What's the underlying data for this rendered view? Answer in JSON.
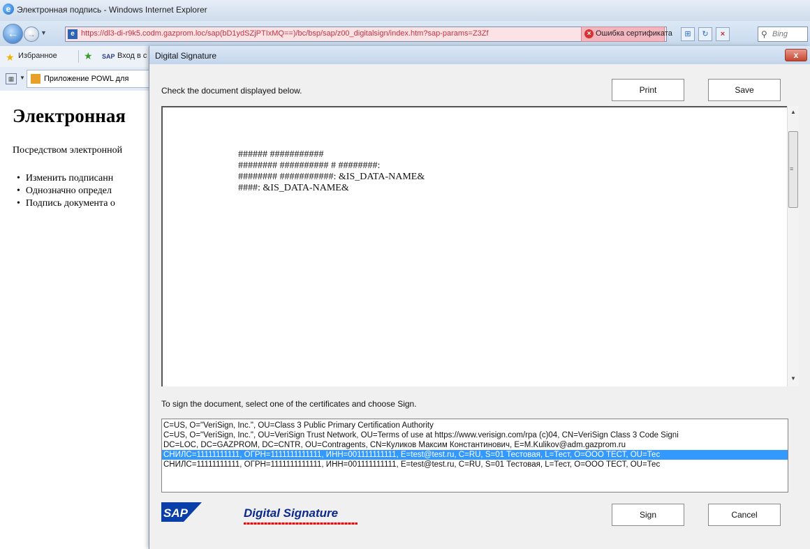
{
  "browser": {
    "window_title": "Электронная подпись - Windows Internet Explorer",
    "url": "https://dl3-di-r9k5.codm.gazprom.loc/sap(bD1ydSZjPTIxMQ==)/bc/bsp/sap/z00_digitalsign/index.htm?sap-params=Z3Zf",
    "cert_error": "Ошибка сертификата",
    "search_placeholder": "Bing",
    "favorites_label": "Избранное",
    "favorite_link": "Вход в с",
    "tab_title": "Приложение POWL для"
  },
  "page": {
    "heading": "Электронная",
    "intro": "Посредством электронной",
    "bullets": [
      "Изменить подписанн",
      "Однозначно определ",
      "Подпись документа о"
    ]
  },
  "dialog": {
    "title": "Digital Signature",
    "check_text": "Check the document displayed below.",
    "print_label": "Print",
    "save_label": "Save",
    "document_lines": [
      "######  ###########",
      "########  ##########  #  ########:",
      "########  ###########:  &IS_DATA-NAME&",
      "####:  &IS_DATA-NAME&"
    ],
    "sign_instruction": "To sign the document, select one of the certificates and choose Sign.",
    "certificates": [
      "C=US, O=\"VeriSign, Inc.\", OU=Class 3 Public Primary Certification Authority",
      "C=US, O=\"VeriSign, Inc.\", OU=VeriSign Trust Network, OU=Terms of use at https://www.verisign.com/rpa (c)04, CN=VeriSign Class 3 Code Signi",
      "DC=LOC, DC=GAZPROM, DC=CNTR, OU=Contragents, CN=Куликов Максим Константинович, E=M.Kulikov@adm.gazprom.ru",
      "СНИЛС=11111111111, ОГРН=1111111111111, ИНН=001111111111, E=test@test.ru, C=RU, S=01 Тестовая, L=Тест, O=ООО ТЕСТ, OU=Тес",
      "СНИЛС=11111111111, ОГРН=1111111111111, ИНН=001111111111, E=test@test.ru, C=RU, S=01 Тестовая, L=Тест, O=ООО ТЕСТ, OU=Тес"
    ],
    "selected_certificate_index": 3,
    "logo_text": "SAP",
    "brand_text": "Digital Signature",
    "sign_label": "Sign",
    "cancel_label": "Cancel",
    "close_label": "x"
  },
  "colors": {
    "selection": "#3399ff",
    "brand_text": "#0b2a8f",
    "cert_error_bg": "#f3b6bf"
  }
}
